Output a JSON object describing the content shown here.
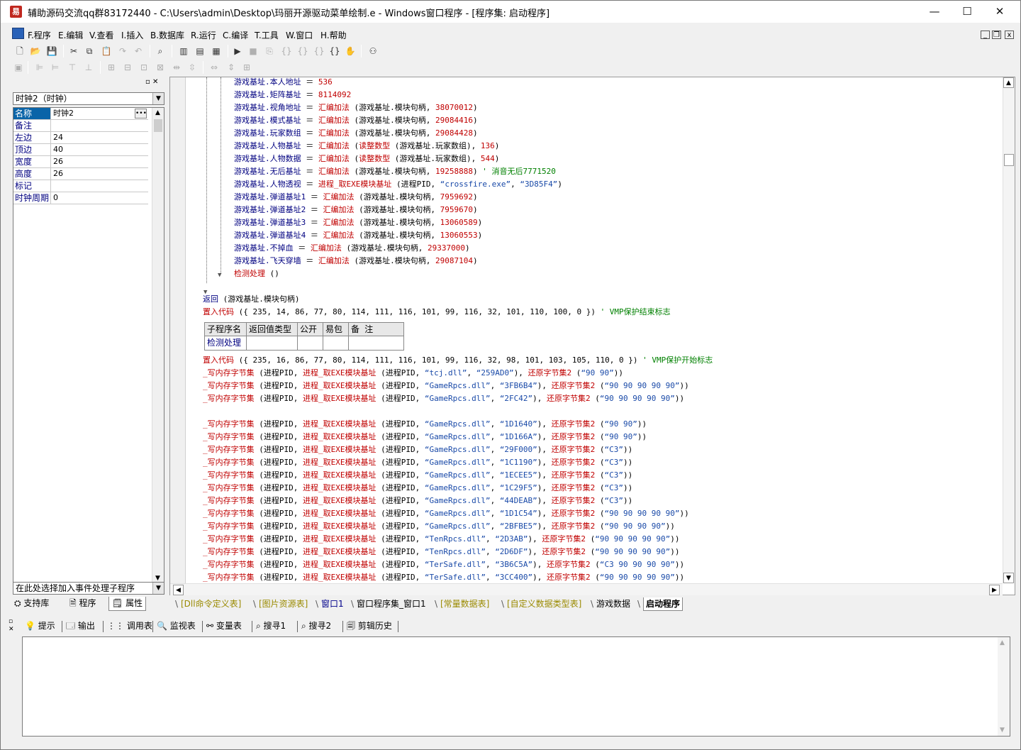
{
  "window": {
    "title": "辅助源码交流qq群83172440 - C:\\Users\\admin\\Desktop\\玛丽开源驱动菜单绘制.e - Windows窗口程序 - [程序集: 启动程序]",
    "minimize": "—",
    "maximize": "☐",
    "close": "✕"
  },
  "menu": {
    "items": [
      "F.程序",
      "E.编辑",
      "V.查看",
      "I.插入",
      "B.数据库",
      "R.运行",
      "C.编译",
      "T.工具",
      "W.窗口",
      "H.帮助"
    ],
    "mdi": [
      "_",
      "❐",
      "x"
    ]
  },
  "left": {
    "component": "时钟2（时钟）",
    "properties": [
      {
        "name": "名称",
        "value": "时钟2"
      },
      {
        "name": "备注",
        "value": ""
      },
      {
        "name": "左边",
        "value": "24"
      },
      {
        "name": "顶边",
        "value": "40"
      },
      {
        "name": "宽度",
        "value": "26"
      },
      {
        "name": "高度",
        "value": "26"
      },
      {
        "name": "标记",
        "value": ""
      },
      {
        "name": "时钟周期",
        "value": "0"
      }
    ],
    "ellipsis": "•••",
    "event_select": "在此处选择加入事件处理子程序",
    "tabs": [
      "支持库",
      "程序",
      "属性"
    ]
  },
  "code": {
    "lines": [
      [
        [
          "v",
          "游戏基址.本人地址 "
        ],
        [
          "p",
          "＝ "
        ],
        [
          "n",
          "536"
        ]
      ],
      [
        [
          "v",
          "游戏基址.矩阵基址 "
        ],
        [
          "p",
          "＝ "
        ],
        [
          "n",
          "8114092"
        ]
      ],
      [
        [
          "v",
          "游戏基址.视角地址 "
        ],
        [
          "p",
          "＝ "
        ],
        [
          "k",
          "汇编加法"
        ],
        [
          "p",
          " (游戏基址.模块句柄, "
        ],
        [
          "n",
          "38070012"
        ],
        [
          "p",
          ")"
        ]
      ],
      [
        [
          "v",
          "游戏基址.模式基址 "
        ],
        [
          "p",
          "＝ "
        ],
        [
          "k",
          "汇编加法"
        ],
        [
          "p",
          " (游戏基址.模块句柄, "
        ],
        [
          "n",
          "29084416"
        ],
        [
          "p",
          ")"
        ]
      ],
      [
        [
          "v",
          "游戏基址.玩家数组 "
        ],
        [
          "p",
          "＝ "
        ],
        [
          "k",
          "汇编加法"
        ],
        [
          "p",
          " (游戏基址.模块句柄, "
        ],
        [
          "n",
          "29084428"
        ],
        [
          "p",
          ")"
        ]
      ],
      [
        [
          "v",
          "游戏基址.人物基址 "
        ],
        [
          "p",
          "＝ "
        ],
        [
          "k",
          "汇编加法"
        ],
        [
          "p",
          " ("
        ],
        [
          "k",
          "读整数型"
        ],
        [
          "p",
          " (游戏基址.玩家数组), "
        ],
        [
          "n",
          "136"
        ],
        [
          "p",
          ")"
        ]
      ],
      [
        [
          "v",
          "游戏基址.人物数据 "
        ],
        [
          "p",
          "＝ "
        ],
        [
          "k",
          "汇编加法"
        ],
        [
          "p",
          " ("
        ],
        [
          "k",
          "读整数型"
        ],
        [
          "p",
          " (游戏基址.玩家数组), "
        ],
        [
          "n",
          "544"
        ],
        [
          "p",
          ")"
        ]
      ],
      [
        [
          "v",
          "游戏基址.无后基址 "
        ],
        [
          "p",
          "＝ "
        ],
        [
          "k",
          "汇编加法"
        ],
        [
          "p",
          " (游戏基址.模块句柄, "
        ],
        [
          "n",
          "19258888"
        ],
        [
          "p",
          ") "
        ],
        [
          "c",
          "' 消音无后7771520"
        ]
      ],
      [
        [
          "v",
          "游戏基址.人物透视 "
        ],
        [
          "p",
          "＝ "
        ],
        [
          "k",
          "进程_取EXE模块基址"
        ],
        [
          "p",
          " (进程PID, "
        ],
        [
          "s",
          "“crossfire.exe”"
        ],
        [
          "p",
          ", "
        ],
        [
          "s",
          "“3D85F4”"
        ],
        [
          "p",
          ")"
        ]
      ],
      [
        [
          "v",
          "游戏基址.弹道基址1 "
        ],
        [
          "p",
          "＝ "
        ],
        [
          "k",
          "汇编加法"
        ],
        [
          "p",
          " (游戏基址.模块句柄, "
        ],
        [
          "n",
          "7959692"
        ],
        [
          "p",
          ")"
        ]
      ],
      [
        [
          "v",
          "游戏基址.弹道基址2 "
        ],
        [
          "p",
          "＝ "
        ],
        [
          "k",
          "汇编加法"
        ],
        [
          "p",
          " (游戏基址.模块句柄, "
        ],
        [
          "n",
          "7959670"
        ],
        [
          "p",
          ")"
        ]
      ],
      [
        [
          "v",
          "游戏基址.弹道基址3 "
        ],
        [
          "p",
          "＝ "
        ],
        [
          "k",
          "汇编加法"
        ],
        [
          "p",
          " (游戏基址.模块句柄, "
        ],
        [
          "n",
          "13060589"
        ],
        [
          "p",
          ")"
        ]
      ],
      [
        [
          "v",
          "游戏基址.弹道基址4 "
        ],
        [
          "p",
          "＝ "
        ],
        [
          "k",
          "汇编加法"
        ],
        [
          "p",
          " (游戏基址.模块句柄, "
        ],
        [
          "n",
          "13060553"
        ],
        [
          "p",
          ")"
        ]
      ],
      [
        [
          "v",
          "游戏基址.不掉血 "
        ],
        [
          "p",
          "＝ "
        ],
        [
          "k",
          "汇编加法"
        ],
        [
          "p",
          " (游戏基址.模块句柄, "
        ],
        [
          "n",
          "29337000"
        ],
        [
          "p",
          ")"
        ]
      ],
      [
        [
          "v",
          "游戏基址.飞天穿墙 "
        ],
        [
          "p",
          "＝ "
        ],
        [
          "k",
          "汇编加法"
        ],
        [
          "p",
          " (游戏基址.模块句柄, "
        ],
        [
          "n",
          "29087104"
        ],
        [
          "p",
          ")"
        ]
      ],
      [
        [
          "k",
          "检测处理"
        ],
        [
          "p",
          " ()"
        ]
      ]
    ],
    "lines2": [
      [
        [
          "v",
          "返回"
        ],
        [
          "p",
          " (游戏基址.模块句柄)"
        ]
      ],
      [
        [
          "k",
          "置入代码"
        ],
        [
          "p",
          " ({ 235, 14, 86, 77, 80, 114, 111, 116, 101, 99, 116, 32, 101, 110, 100, 0 }) "
        ],
        [
          "c",
          "' VMP保护结束标志"
        ]
      ]
    ],
    "sub_table": {
      "headers": [
        "子程序名",
        "返回值类型",
        "公开",
        "易包",
        "备 注"
      ],
      "row": [
        "检测处理",
        "",
        "",
        "",
        ""
      ]
    },
    "lines3": [
      [
        [
          "k",
          "置入代码"
        ],
        [
          "p",
          " ({ 235, 16, 86, 77, 80, 114, 111, 116, 101, 99, 116, 32, 98, 101, 103, 105, 110, 0 }) "
        ],
        [
          "c",
          "' VMP保护开始标志"
        ]
      ],
      [
        [
          "k",
          "_写内存字节集"
        ],
        [
          "p",
          " (进程PID, "
        ],
        [
          "k",
          "进程_取EXE模块基址"
        ],
        [
          "p",
          " (进程PID, "
        ],
        [
          "s",
          "“tcj.dll”"
        ],
        [
          "p",
          ", "
        ],
        [
          "s",
          "“259AD0”"
        ],
        [
          "p",
          "), "
        ],
        [
          "k",
          "还原字节集2"
        ],
        [
          "p",
          " ("
        ],
        [
          "s",
          "“90 90”"
        ],
        [
          "p",
          "))"
        ]
      ],
      [
        [
          "k",
          "_写内存字节集"
        ],
        [
          "p",
          " (进程PID, "
        ],
        [
          "k",
          "进程_取EXE模块基址"
        ],
        [
          "p",
          " (进程PID, "
        ],
        [
          "s",
          "“GameRpcs.dll”"
        ],
        [
          "p",
          ", "
        ],
        [
          "s",
          "“3FB6B4”"
        ],
        [
          "p",
          "), "
        ],
        [
          "k",
          "还原字节集2"
        ],
        [
          "p",
          " ("
        ],
        [
          "s",
          "“90 90 90 90 90”"
        ],
        [
          "p",
          "))"
        ]
      ],
      [
        [
          "k",
          "_写内存字节集"
        ],
        [
          "p",
          " (进程PID, "
        ],
        [
          "k",
          "进程_取EXE模块基址"
        ],
        [
          "p",
          " (进程PID, "
        ],
        [
          "s",
          "“GameRpcs.dll”"
        ],
        [
          "p",
          ", "
        ],
        [
          "s",
          "“2FC42”"
        ],
        [
          "p",
          "), "
        ],
        [
          "k",
          "还原字节集2"
        ],
        [
          "p",
          " ("
        ],
        [
          "s",
          "“90 90 90 90 90”"
        ],
        [
          "p",
          "))"
        ]
      ],
      [],
      [
        [
          "k",
          "_写内存字节集"
        ],
        [
          "p",
          " (进程PID, "
        ],
        [
          "k",
          "进程_取EXE模块基址"
        ],
        [
          "p",
          " (进程PID, "
        ],
        [
          "s",
          "“GameRpcs.dll”"
        ],
        [
          "p",
          ", "
        ],
        [
          "s",
          "“1D1640”"
        ],
        [
          "p",
          "), "
        ],
        [
          "k",
          "还原字节集2"
        ],
        [
          "p",
          " ("
        ],
        [
          "s",
          "“90 90”"
        ],
        [
          "p",
          "))"
        ]
      ],
      [
        [
          "k",
          "_写内存字节集"
        ],
        [
          "p",
          " (进程PID, "
        ],
        [
          "k",
          "进程_取EXE模块基址"
        ],
        [
          "p",
          " (进程PID, "
        ],
        [
          "s",
          "“GameRpcs.dll”"
        ],
        [
          "p",
          ", "
        ],
        [
          "s",
          "“1D166A”"
        ],
        [
          "p",
          "), "
        ],
        [
          "k",
          "还原字节集2"
        ],
        [
          "p",
          " ("
        ],
        [
          "s",
          "“90 90”"
        ],
        [
          "p",
          "))"
        ]
      ],
      [
        [
          "k",
          "_写内存字节集"
        ],
        [
          "p",
          " (进程PID, "
        ],
        [
          "k",
          "进程_取EXE模块基址"
        ],
        [
          "p",
          " (进程PID, "
        ],
        [
          "s",
          "“GameRpcs.dll”"
        ],
        [
          "p",
          ", "
        ],
        [
          "s",
          "“29F000”"
        ],
        [
          "p",
          "), "
        ],
        [
          "k",
          "还原字节集2"
        ],
        [
          "p",
          " ("
        ],
        [
          "s",
          "“C3”"
        ],
        [
          "p",
          "))"
        ]
      ],
      [
        [
          "k",
          "_写内存字节集"
        ],
        [
          "p",
          " (进程PID, "
        ],
        [
          "k",
          "进程_取EXE模块基址"
        ],
        [
          "p",
          " (进程PID, "
        ],
        [
          "s",
          "“GameRpcs.dll”"
        ],
        [
          "p",
          ", "
        ],
        [
          "s",
          "“1C1190”"
        ],
        [
          "p",
          "), "
        ],
        [
          "k",
          "还原字节集2"
        ],
        [
          "p",
          " ("
        ],
        [
          "s",
          "“C3”"
        ],
        [
          "p",
          "))"
        ]
      ],
      [
        [
          "k",
          "_写内存字节集"
        ],
        [
          "p",
          " (进程PID, "
        ],
        [
          "k",
          "进程_取EXE模块基址"
        ],
        [
          "p",
          " (进程PID, "
        ],
        [
          "s",
          "“GameRpcs.dll”"
        ],
        [
          "p",
          ", "
        ],
        [
          "s",
          "“1ECEE5”"
        ],
        [
          "p",
          "), "
        ],
        [
          "k",
          "还原字节集2"
        ],
        [
          "p",
          " ("
        ],
        [
          "s",
          "“C3”"
        ],
        [
          "p",
          "))"
        ]
      ],
      [
        [
          "k",
          "_写内存字节集"
        ],
        [
          "p",
          " (进程PID, "
        ],
        [
          "k",
          "进程_取EXE模块基址"
        ],
        [
          "p",
          " (进程PID, "
        ],
        [
          "s",
          "“GameRpcs.dll”"
        ],
        [
          "p",
          ", "
        ],
        [
          "s",
          "“1C29F5”"
        ],
        [
          "p",
          "), "
        ],
        [
          "k",
          "还原字节集2"
        ],
        [
          "p",
          " ("
        ],
        [
          "s",
          "“C3”"
        ],
        [
          "p",
          "))"
        ]
      ],
      [
        [
          "k",
          "_写内存字节集"
        ],
        [
          "p",
          " (进程PID, "
        ],
        [
          "k",
          "进程_取EXE模块基址"
        ],
        [
          "p",
          " (进程PID, "
        ],
        [
          "s",
          "“GameRpcs.dll”"
        ],
        [
          "p",
          ", "
        ],
        [
          "s",
          "“44DEAB”"
        ],
        [
          "p",
          "), "
        ],
        [
          "k",
          "还原字节集2"
        ],
        [
          "p",
          " ("
        ],
        [
          "s",
          "“C3”"
        ],
        [
          "p",
          "))"
        ]
      ],
      [
        [
          "k",
          "_写内存字节集"
        ],
        [
          "p",
          " (进程PID, "
        ],
        [
          "k",
          "进程_取EXE模块基址"
        ],
        [
          "p",
          " (进程PID, "
        ],
        [
          "s",
          "“GameRpcs.dll”"
        ],
        [
          "p",
          ", "
        ],
        [
          "s",
          "“1D1C54”"
        ],
        [
          "p",
          "), "
        ],
        [
          "k",
          "还原字节集2"
        ],
        [
          "p",
          " ("
        ],
        [
          "s",
          "“90 90 90 90 90”"
        ],
        [
          "p",
          "))"
        ]
      ],
      [
        [
          "k",
          "_写内存字节集"
        ],
        [
          "p",
          " (进程PID, "
        ],
        [
          "k",
          "进程_取EXE模块基址"
        ],
        [
          "p",
          " (进程PID, "
        ],
        [
          "s",
          "“GameRpcs.dll”"
        ],
        [
          "p",
          ", "
        ],
        [
          "s",
          "“2BFBE5”"
        ],
        [
          "p",
          "), "
        ],
        [
          "k",
          "还原字节集2"
        ],
        [
          "p",
          " ("
        ],
        [
          "s",
          "“90 90 90 90”"
        ],
        [
          "p",
          "))"
        ]
      ],
      [
        [
          "k",
          "_写内存字节集"
        ],
        [
          "p",
          " (进程PID, "
        ],
        [
          "k",
          "进程_取EXE模块基址"
        ],
        [
          "p",
          " (进程PID, "
        ],
        [
          "s",
          "“TenRpcs.dll”"
        ],
        [
          "p",
          ", "
        ],
        [
          "s",
          "“2D3AB”"
        ],
        [
          "p",
          "), "
        ],
        [
          "k",
          "还原字节集2"
        ],
        [
          "p",
          " ("
        ],
        [
          "s",
          "“90 90 90 90 90”"
        ],
        [
          "p",
          "))"
        ]
      ],
      [
        [
          "k",
          "_写内存字节集"
        ],
        [
          "p",
          " (进程PID, "
        ],
        [
          "k",
          "进程_取EXE模块基址"
        ],
        [
          "p",
          " (进程PID, "
        ],
        [
          "s",
          "“TenRpcs.dll”"
        ],
        [
          "p",
          ", "
        ],
        [
          "s",
          "“2D6DF”"
        ],
        [
          "p",
          "), "
        ],
        [
          "k",
          "还原字节集2"
        ],
        [
          "p",
          " ("
        ],
        [
          "s",
          "“90 90 90 90 90”"
        ],
        [
          "p",
          "))"
        ]
      ],
      [
        [
          "k",
          "_写内存字节集"
        ],
        [
          "p",
          " (进程PID, "
        ],
        [
          "k",
          "进程_取EXE模块基址"
        ],
        [
          "p",
          " (进程PID, "
        ],
        [
          "s",
          "“TerSafe.dll”"
        ],
        [
          "p",
          ", "
        ],
        [
          "s",
          "“3B6C5A”"
        ],
        [
          "p",
          "), "
        ],
        [
          "k",
          "还原字节集2"
        ],
        [
          "p",
          " ("
        ],
        [
          "s",
          "“C3 90 90 90 90”"
        ],
        [
          "p",
          "))"
        ]
      ],
      [
        [
          "k",
          "_写内存字节集"
        ],
        [
          "p",
          " (进程PID, "
        ],
        [
          "k",
          "进程_取EXE模块基址"
        ],
        [
          "p",
          " (进程PID, "
        ],
        [
          "s",
          "“TerSafe.dll”"
        ],
        [
          "p",
          ", "
        ],
        [
          "s",
          "“3CC400”"
        ],
        [
          "p",
          "), "
        ],
        [
          "k",
          "还原字节集2"
        ],
        [
          "p",
          " ("
        ],
        [
          "s",
          "“90 90 90 90 90”"
        ],
        [
          "p",
          "))"
        ]
      ]
    ]
  },
  "doc_tabs": [
    {
      "label": "[Dll命令定义表]",
      "style": "y"
    },
    {
      "label": "[图片资源表]",
      "style": "y"
    },
    {
      "label": "窗口1",
      "style": "bl"
    },
    {
      "label": "窗口程序集_窗口1",
      "style": ""
    },
    {
      "label": "[常量数据表]",
      "style": "y"
    },
    {
      "label": "[自定义数据类型表]",
      "style": "y"
    },
    {
      "label": "游戏数据",
      "style": ""
    },
    {
      "label": "启动程序",
      "style": "act"
    }
  ],
  "bottom_tabs": [
    "提示",
    "输出",
    "调用表",
    "监视表",
    "变量表",
    "搜寻1",
    "搜寻2",
    "剪辑历史"
  ],
  "colors": {
    "selected_row": "#0a64a8",
    "keyword": "#c00000",
    "variable": "#000080",
    "string": "#1a4aa8",
    "comment": "#008000"
  }
}
